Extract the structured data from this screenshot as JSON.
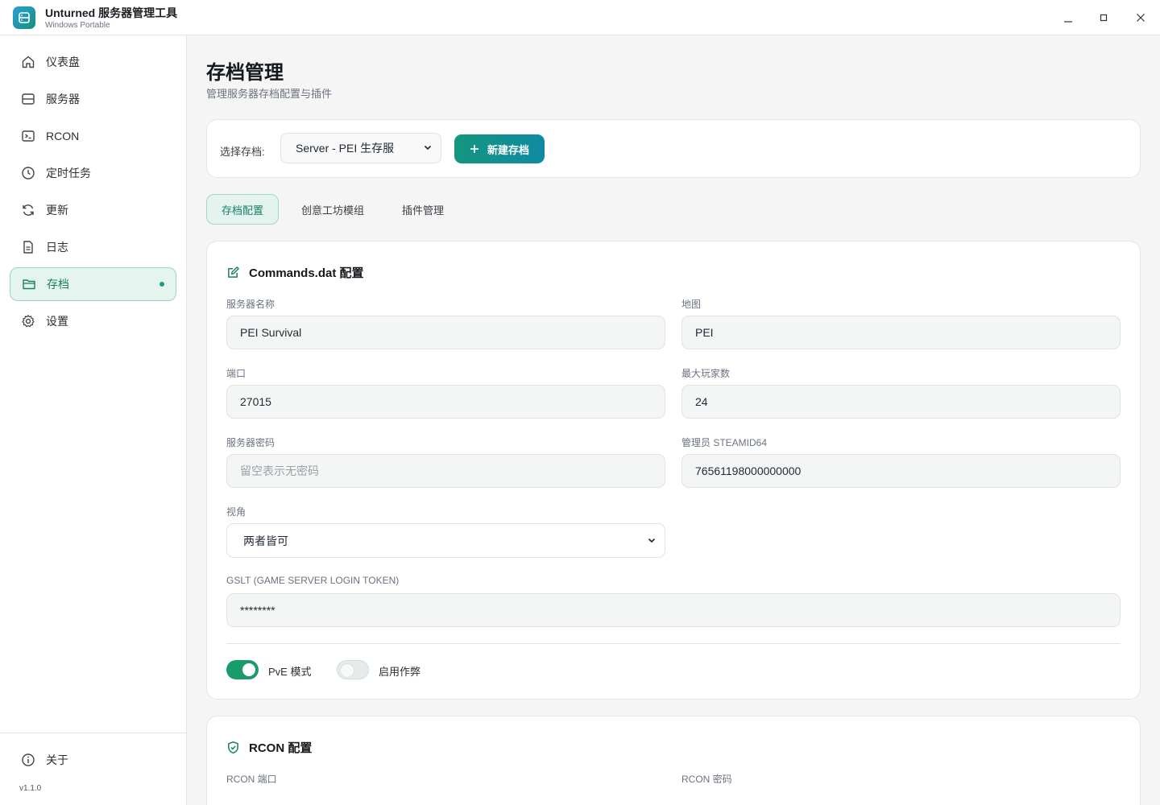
{
  "app": {
    "title": "Unturned 服务器管理工具",
    "subtitle": "Windows Portable"
  },
  "window_controls": {
    "minimize": "–",
    "maximize": "□",
    "close": "✕"
  },
  "sidebar": {
    "items": [
      {
        "label": "仪表盘",
        "icon": "home-icon"
      },
      {
        "label": "服务器",
        "icon": "server-icon"
      },
      {
        "label": "RCON",
        "icon": "terminal-icon"
      },
      {
        "label": "定时任务",
        "icon": "clock-icon"
      },
      {
        "label": "更新",
        "icon": "refresh-icon"
      },
      {
        "label": "日志",
        "icon": "document-icon"
      },
      {
        "label": "存档",
        "icon": "folder-icon",
        "active": true
      },
      {
        "label": "设置",
        "icon": "gear-icon"
      }
    ],
    "about": {
      "label": "关于",
      "icon": "info-icon"
    },
    "version": "v1.1.0"
  },
  "page": {
    "title": "存档管理",
    "subtitle": "管理服务器存档配置与插件"
  },
  "save_selector": {
    "label": "选择存档:",
    "selected": "Server - PEI 生存服",
    "new_button": "新建存档"
  },
  "tabs": [
    {
      "label": "存档配置",
      "active": true
    },
    {
      "label": "创意工坊模组",
      "active": false
    },
    {
      "label": "插件管理",
      "active": false
    }
  ],
  "commands_section": {
    "title": "Commands.dat 配置",
    "server_name": {
      "label": "服务器名称",
      "value": "PEI Survival"
    },
    "map": {
      "label": "地图",
      "value": "PEI"
    },
    "port": {
      "label": "端口",
      "value": "27015"
    },
    "max_players": {
      "label": "最大玩家数",
      "value": "24"
    },
    "password": {
      "label": "服务器密码",
      "value": "",
      "placeholder": "留空表示无密码"
    },
    "admin_steamid": {
      "label": "管理员 STEAMID64",
      "value": "76561198000000000"
    },
    "perspective": {
      "label": "视角",
      "value": "两者皆可"
    },
    "gslt": {
      "label": "GSLT (GAME SERVER LOGIN TOKEN)",
      "value": "********"
    },
    "toggles": [
      {
        "label": "PvE 模式",
        "on": true
      },
      {
        "label": "启用作弊",
        "on": false
      }
    ]
  },
  "rcon_section": {
    "title": "RCON 配置",
    "port_label": "RCON 端口",
    "password_label": "RCON 密码"
  },
  "colors": {
    "accent": "#16a085",
    "button_gradient_start": "#14967e",
    "button_gradient_end": "#0f8aa3",
    "toggle_on": "#1a9b6c"
  }
}
